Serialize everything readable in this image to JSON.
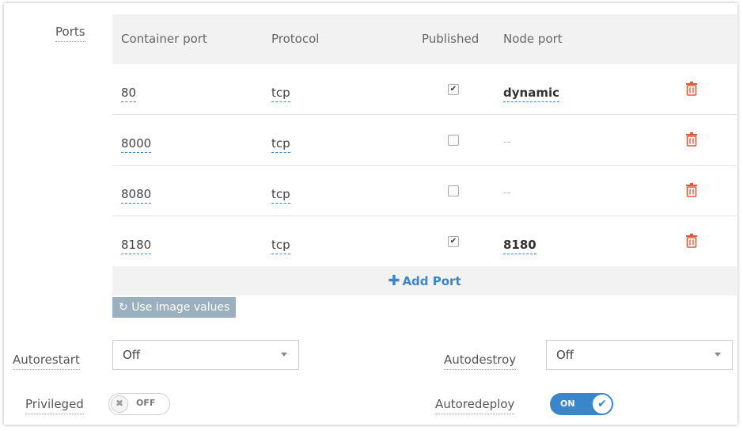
{
  "ports": {
    "label": "Ports",
    "headers": {
      "container_port": "Container port",
      "protocol": "Protocol",
      "published": "Published",
      "node_port": "Node port"
    },
    "rows": [
      {
        "container_port": "80",
        "protocol": "tcp",
        "published": true,
        "node_port": "dynamic"
      },
      {
        "container_port": "8000",
        "protocol": "tcp",
        "published": false,
        "node_port": "--"
      },
      {
        "container_port": "8080",
        "protocol": "tcp",
        "published": false,
        "node_port": "--"
      },
      {
        "container_port": "8180",
        "protocol": "tcp",
        "published": true,
        "node_port": "8180"
      }
    ],
    "add_port_label": "Add Port",
    "add_port_icon": "plus-icon",
    "delete_icon": "trash-icon"
  },
  "use_image_values": {
    "label": "Use image values",
    "icon": "undo-icon"
  },
  "autorestart": {
    "label": "Autorestart",
    "value": "Off"
  },
  "autodestroy": {
    "label": "Autodestroy",
    "value": "Off"
  },
  "privileged": {
    "label": "Privileged",
    "state": "OFF"
  },
  "autoredeploy": {
    "label": "Autoredeploy",
    "state": "ON"
  },
  "colors": {
    "accent": "#3a86c8",
    "delete": "#e05a3a",
    "header_bg": "#f2f2f2",
    "button_bg": "#9ab0bf"
  }
}
